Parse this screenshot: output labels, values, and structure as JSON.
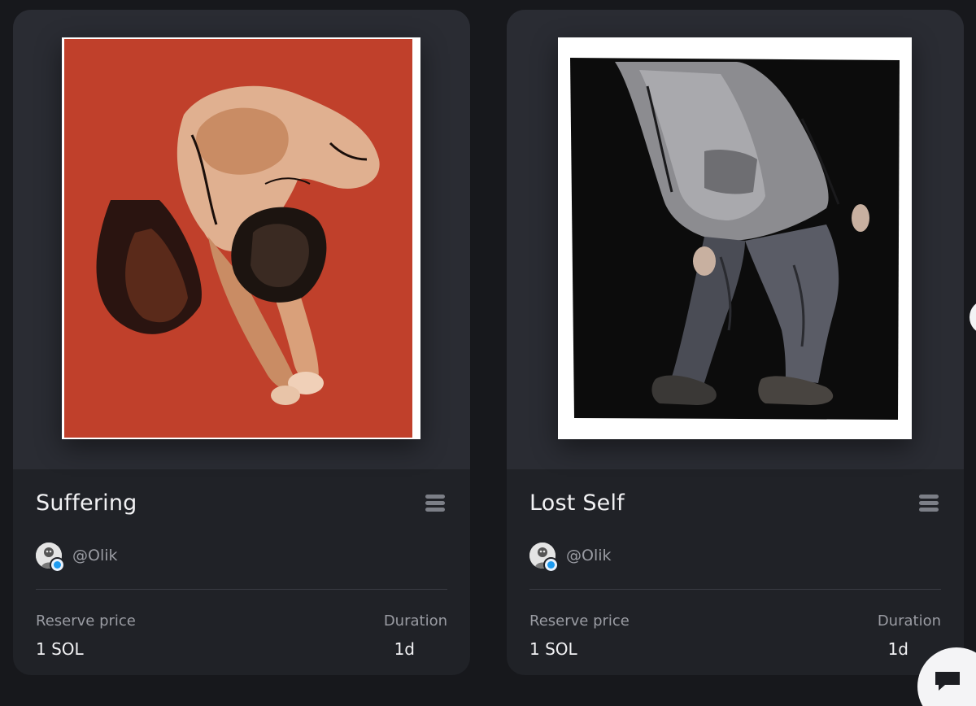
{
  "cards": [
    {
      "title": "Suffering",
      "creator_handle": "@Olik",
      "reserve_label": "Reserve price",
      "reserve_value": "1 SOL",
      "duration_label": "Duration",
      "duration_value": "1d"
    },
    {
      "title": "Lost Self",
      "creator_handle": "@Olik",
      "reserve_label": "Reserve price",
      "reserve_value": "1 SOL",
      "duration_label": "Duration",
      "duration_value": "1d"
    }
  ],
  "icons": {
    "menu": "menu-icon",
    "verified": "twitter-verified-icon",
    "chat": "chat-icon",
    "scroll": "chevron-right-icon"
  },
  "colors": {
    "background": "#17181c",
    "card": "#202227",
    "art_area": "#2a2c33",
    "art1_red": "#c0402b",
    "accent_blue": "#1d9bf0"
  }
}
